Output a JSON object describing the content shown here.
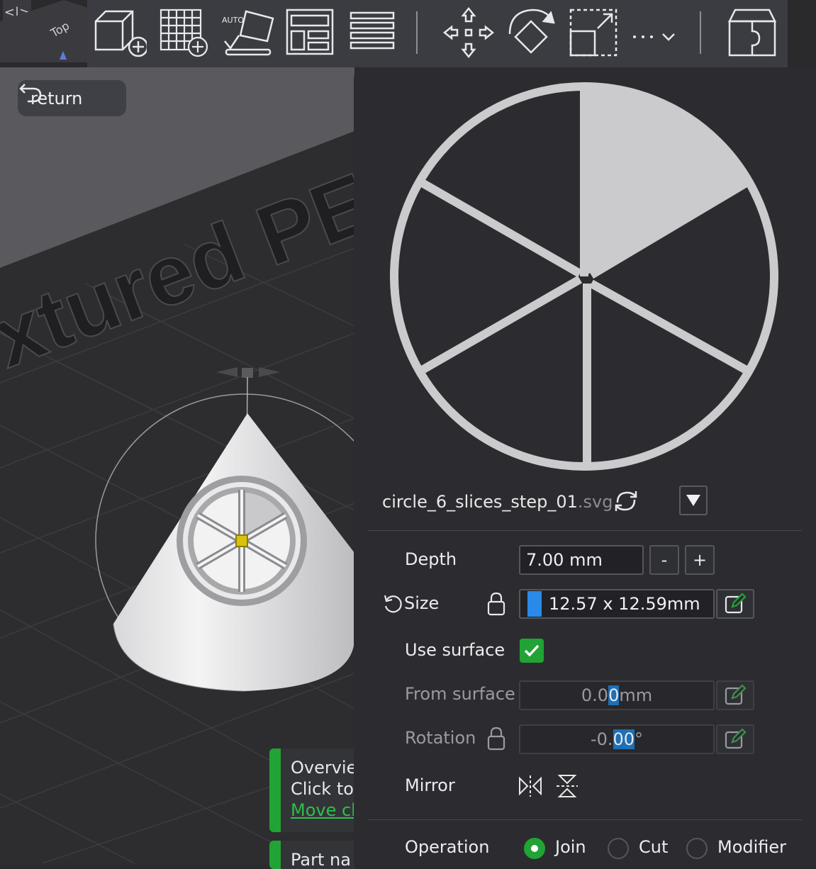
{
  "toolbar": {
    "items": [
      "add-object-icon",
      "add-plate-icon",
      "auto-arrange-icon",
      "layout-icon",
      "list-icon",
      "move-icon",
      "rotate-icon",
      "scale-icon",
      "more-icon",
      "assembly-icon"
    ],
    "auto_label": "AUTO"
  },
  "viewport": {
    "return_label": "return",
    "bed_text": "xtured PE",
    "viewcube_label": "Top",
    "notifications": [
      {
        "line1": "Overvie",
        "line2": "Click to",
        "link": "Move cl"
      },
      {
        "line1": "Part na"
      }
    ]
  },
  "panel": {
    "file_name": "circle_6_slices_step_01",
    "file_ext": ".svg",
    "depth": {
      "label": "Depth",
      "value": "7.00 mm",
      "minus": "-",
      "plus": "+"
    },
    "size": {
      "label": "Size",
      "value": "12.57 x 12.59mm"
    },
    "use_surface": {
      "label": "Use surface",
      "checked": true
    },
    "from_surface": {
      "label": "From surface",
      "value_before": "0.0",
      "value_cursor": "0",
      "value_after": " mm"
    },
    "rotation": {
      "label": "Rotation",
      "value_before": "-0.",
      "value_cursor": "00",
      "value_after": " °"
    },
    "mirror": {
      "label": "Mirror"
    },
    "operation": {
      "label": "Operation",
      "options": [
        "Join",
        "Cut",
        "Modifier"
      ],
      "selected": "Join"
    }
  },
  "colors": {
    "accent_green": "#21a336",
    "panel_bg": "#2c2c30",
    "toolbar_bg": "#3b3c41",
    "selection_blue": "#1f6fb5"
  }
}
